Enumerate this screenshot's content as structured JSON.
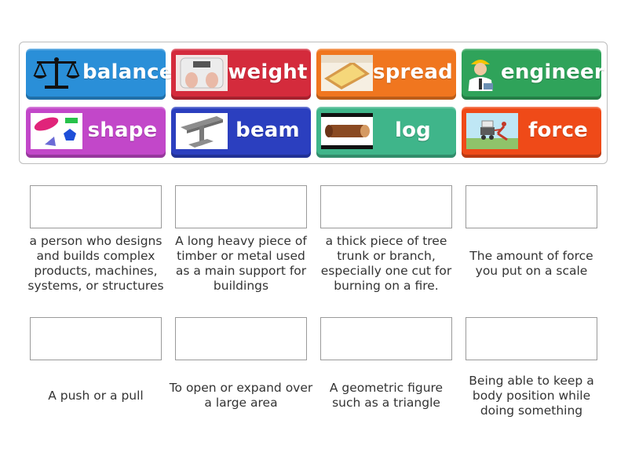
{
  "tiles": [
    {
      "label": "balance",
      "icon": "balance-scale-icon",
      "color": "#2a8fd8"
    },
    {
      "label": "weight",
      "icon": "bathroom-scale-icon",
      "color": "#d42b3c"
    },
    {
      "label": "spread",
      "icon": "butter-toast-icon",
      "color": "#f0761f"
    },
    {
      "label": "engineer",
      "icon": "engineer-person-icon",
      "color": "#2fa35a"
    },
    {
      "label": "shape",
      "icon": "shapes-icon",
      "color": "#c247c9"
    },
    {
      "label": "beam",
      "icon": "steel-beam-icon",
      "color": "#2b3fbf"
    },
    {
      "label": "log",
      "icon": "wood-log-icon",
      "color": "#3fb58a"
    },
    {
      "label": "force",
      "icon": "push-cart-icon",
      "color": "#ef4a18"
    }
  ],
  "definitions": [
    "a person who designs and builds complex products, machines, systems, or structures",
    "A long heavy piece of timber or metal used as a main support for buildings",
    "a thick piece of tree trunk or branch, especially one cut for burning on a fire.",
    "The amount of force you put on a scale",
    "A push or a pull",
    "To open or expand over a large area",
    "A geometric figure such as a triangle",
    "Being able to keep a body position while doing something"
  ]
}
